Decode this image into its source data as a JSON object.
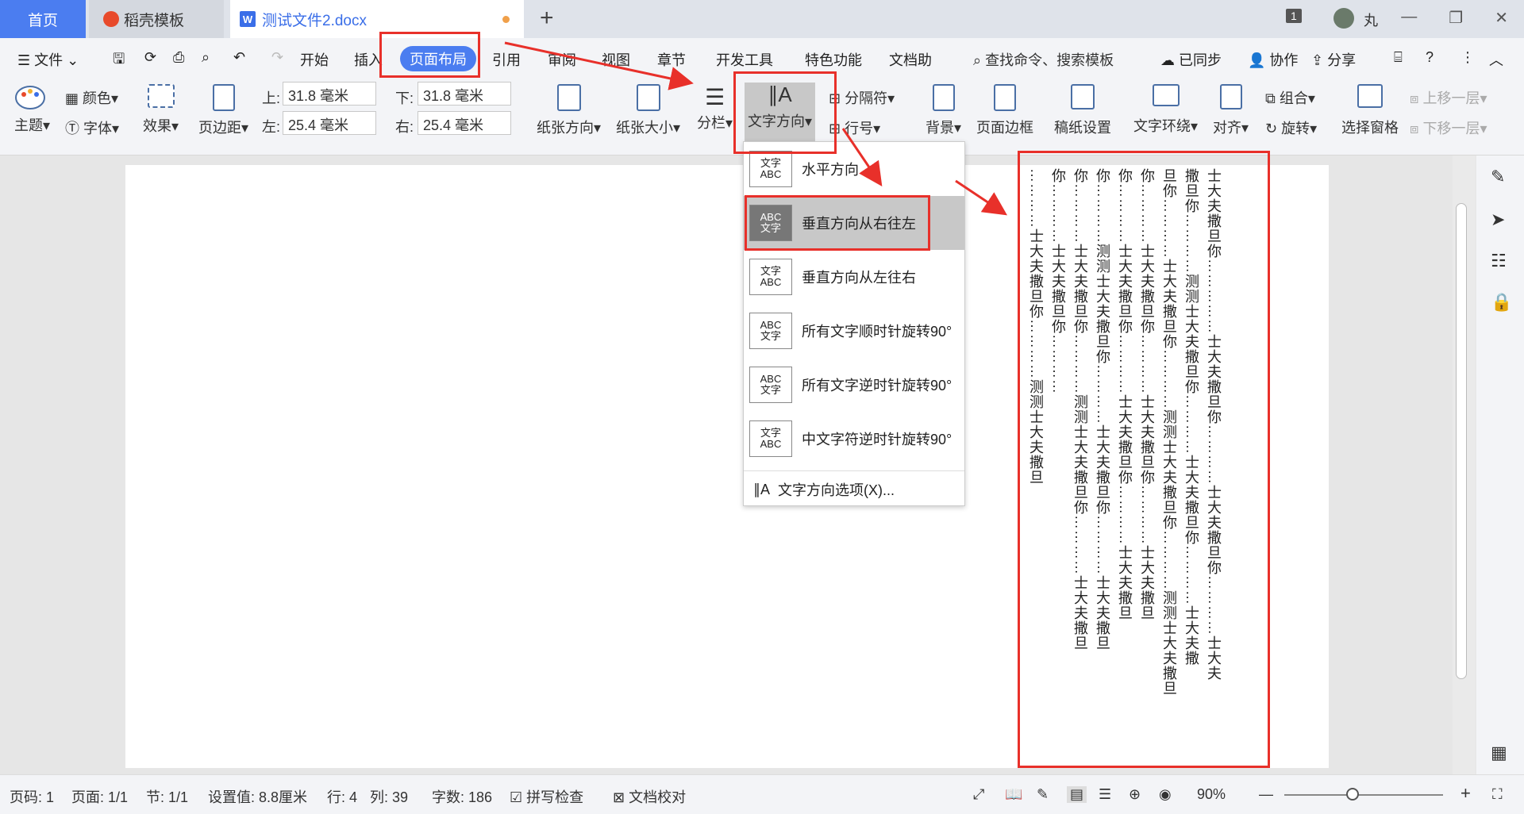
{
  "tabs": {
    "home": "首页",
    "daoke": "稻壳模板",
    "doc": "测试文件2.docx"
  },
  "window": {
    "badge": "1",
    "user": "丸"
  },
  "menu": {
    "file": "文件",
    "items": [
      "开始",
      "插入",
      "页面布局",
      "引用",
      "审阅",
      "视图",
      "章节",
      "开发工具",
      "特色功能",
      "文档助"
    ],
    "search": "查找命令、搜索模板",
    "synced": "已同步",
    "collab": "协作",
    "share": "分享"
  },
  "ribbon": {
    "theme": "主题",
    "color": "颜色",
    "font": "字体",
    "effect": "效果",
    "margin": "页边距",
    "top_label": "上:",
    "top_val": "31.8 毫米",
    "bottom_label": "下:",
    "bottom_val": "31.8 毫米",
    "left_label": "左:",
    "left_val": "25.4 毫米",
    "right_label": "右:",
    "right_val": "25.4 毫米",
    "orientation": "纸张方向",
    "size": "纸张大小",
    "columns": "分栏",
    "text_dir": "文字方向",
    "break": "分隔符",
    "line_num": "行号",
    "background": "背景",
    "page_border": "页面边框",
    "draft": "稿纸设置",
    "wrap": "文字环绕",
    "align": "对齐",
    "group": "组合",
    "rotate": "旋转",
    "select_pane": "选择窗格",
    "bring_up": "上移一层",
    "send_down": "下移一层"
  },
  "dropdown": {
    "items": [
      {
        "icon": "文字\nABC",
        "label": "水平方向"
      },
      {
        "icon": "ABC\n文字",
        "label": "垂直方向从右往左"
      },
      {
        "icon": "文字\nABC",
        "label": "垂直方向从左往右"
      },
      {
        "icon": "ABC\n文字",
        "label": "所有文字顺时针旋转90°"
      },
      {
        "icon": "ABC\n文字",
        "label": "所有文字逆时针旋转90°"
      },
      {
        "icon": "文字\nABC",
        "label": "中文字符逆时针旋转90°"
      }
    ],
    "options": "文字方向选项(X)..."
  },
  "doc_columns": [
    "士大夫撒旦你……………士大夫撒旦你…………士大夫撒旦你…………士大夫",
    "撒旦你…………测测士大夫撒旦你…………士大夫撒旦你…………士大夫撒",
    "旦你…………士大夫撒旦你…………测测士大夫撒旦你…………测测士大夫撒旦",
    "你…………士大夫撒旦你…………士大夫撒旦你…………士大夫撒旦",
    "你…………士大夫撒旦你…………士大夫撒旦你…………士大夫撒旦",
    "你…………测测士大夫撒旦你…………士大夫撒旦你…………士大夫撒旦",
    "你…………士大夫撒旦你…………测测士大夫撒旦你…………士大夫撒旦",
    "你…………士大夫撒旦你…………",
    "…………士大夫撒旦你…………测测士大夫撒旦"
  ],
  "status": {
    "page_no": "页码: 1",
    "pages": "页面: 1/1",
    "section": "节: 1/1",
    "setting": "设置值: 8.8厘米",
    "row": "行: 4",
    "col": "列: 39",
    "words": "字数: 186",
    "spell": "拼写检查",
    "proof": "文档校对",
    "zoom": "90%"
  },
  "colors": {
    "accent": "#4b7df0",
    "annotation": "#e8302a"
  }
}
